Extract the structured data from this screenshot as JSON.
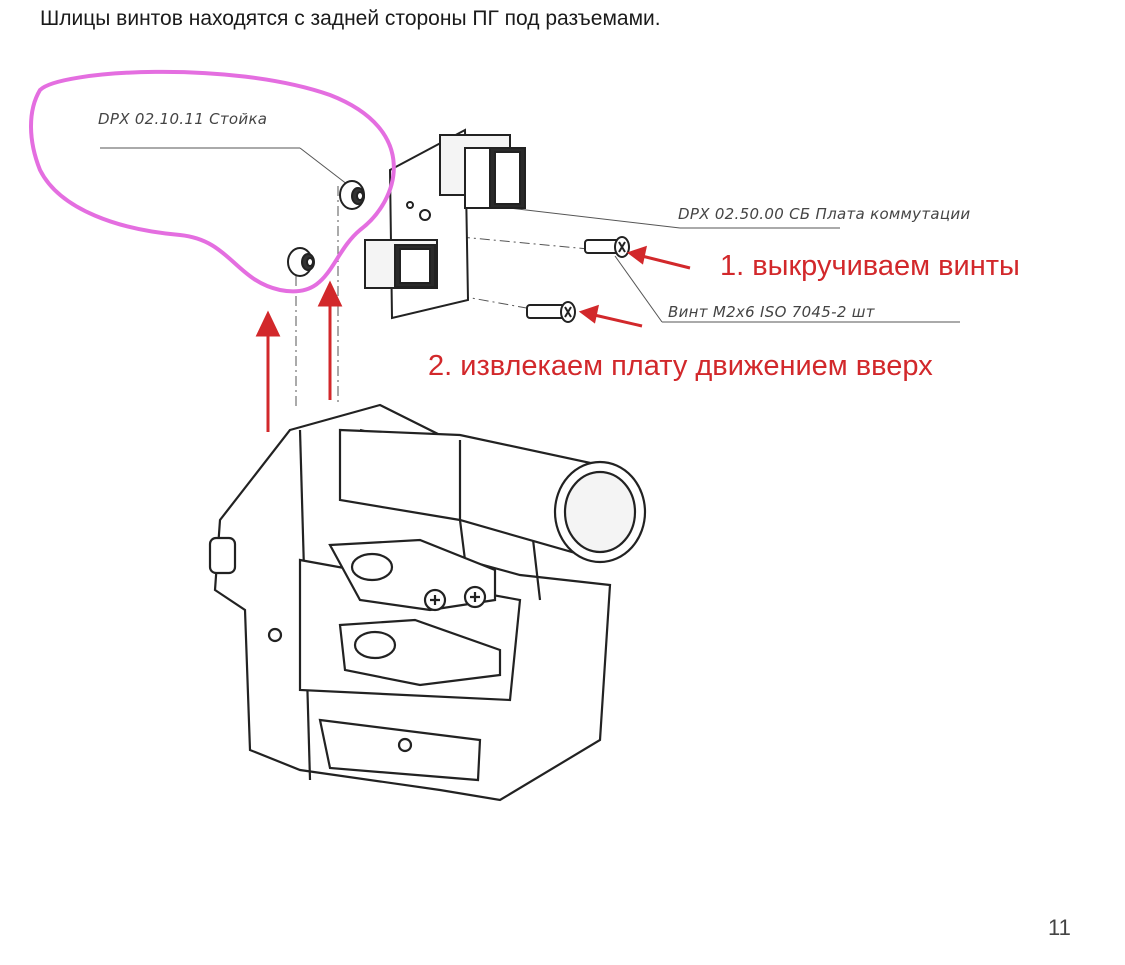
{
  "heading": "Шлицы винтов находятся с задней стороны ПГ под разъемами.",
  "callouts": {
    "standoff": "DPX 02.10.11 Стойка",
    "board": "DPX 02.50.00 СБ Плата коммутации",
    "screw": "Винт M2x6 ISO 7045-2 шт"
  },
  "steps": {
    "step1": "1.  выкручиваем винты",
    "step2": "2.  извлекаем плату движением вверх"
  },
  "page_number": "11",
  "colors": {
    "annotation_red": "#d2282b",
    "highlight_pink": "#e46ee0"
  }
}
